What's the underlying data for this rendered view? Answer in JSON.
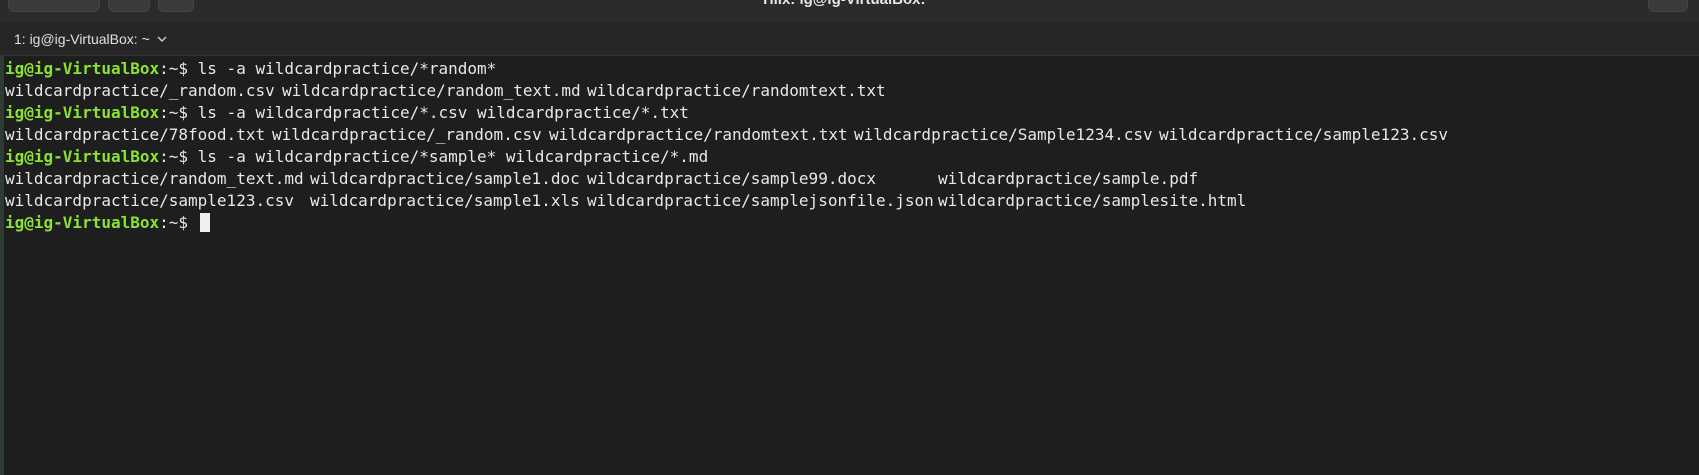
{
  "window": {
    "title": "Tilix: ig@ig-VirtualBox: ~"
  },
  "tab": {
    "label": "1: ig@ig-VirtualBox: ~"
  },
  "prompt": {
    "user_host": "ig@ig-VirtualBox",
    "path": ":~$ "
  },
  "session": [
    {
      "cmd": "ls -a wildcardpractice/*random*",
      "output_rows": [
        [
          "wildcardpractice/_random.csv",
          "wildcardpractice/random_text.md",
          "wildcardpractice/randomtext.txt"
        ]
      ]
    },
    {
      "cmd": "ls -a wildcardpractice/*.csv wildcardpractice/*.txt",
      "output_rows": [
        [
          "wildcardpractice/78food.txt",
          "wildcardpractice/_random.csv",
          "wildcardpractice/randomtext.txt",
          "wildcardpractice/Sample1234.csv",
          "wildcardpractice/sample123.csv"
        ]
      ]
    },
    {
      "cmd": "ls -a wildcardpractice/*sample* wildcardpractice/*.md",
      "output_rows": [
        [
          "wildcardpractice/random_text.md",
          "wildcardpractice/sample1.doc",
          "wildcardpractice/sample99.docx",
          "wildcardpractice/sample.pdf"
        ],
        [
          "wildcardpractice/sample123.csv",
          "wildcardpractice/sample1.xls",
          "wildcardpractice/samplejsonfile.json",
          "wildcardpractice/samplesite.html"
        ]
      ]
    }
  ]
}
